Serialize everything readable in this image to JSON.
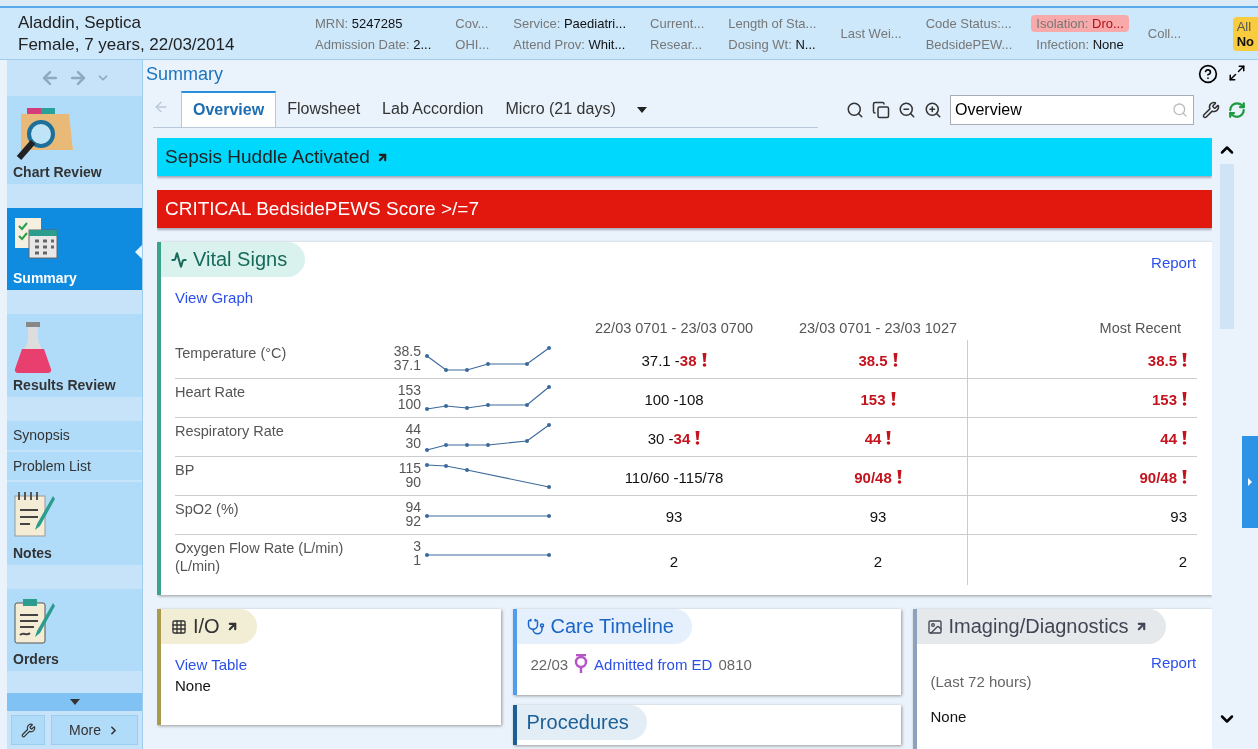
{
  "patient": {
    "name": "Aladdin, Septica",
    "details": "Female, 7 years, 22/03/2014"
  },
  "header_columns": [
    {
      "fields": [
        {
          "label": "MRN:",
          "value": "5247285",
          "highlight": false
        },
        {
          "label": "Admission Date:",
          "value": "2...",
          "highlight": false
        }
      ]
    },
    {
      "fields": [
        {
          "label": "Cov...",
          "highlight": false
        },
        {
          "label": "OHI...",
          "highlight": false
        }
      ]
    },
    {
      "fields": [
        {
          "label": "Service:",
          "value": "Paediatri...",
          "highlight": false
        },
        {
          "label": "Attend Prov:",
          "value": "Whit...",
          "highlight": false
        }
      ]
    },
    {
      "fields": [
        {
          "label": "Current...",
          "highlight": false
        },
        {
          "label": "Resear...",
          "highlight": false
        }
      ]
    },
    {
      "fields": [
        {
          "label": "Length of Sta...",
          "highlight": false
        },
        {
          "label": "Dosing Wt:",
          "value": "N...",
          "highlight": false
        }
      ]
    },
    {
      "fields": [
        {
          "label": "Last Wei...",
          "highlight": false
        }
      ]
    },
    {
      "fields": [
        {
          "label": "Code Status:...",
          "highlight": false
        },
        {
          "label": "BedsidePEW...",
          "highlight": false
        }
      ]
    },
    {
      "fields": [
        {
          "label": "Isolation:",
          "value": "Dro...",
          "highlight": true
        },
        {
          "label": "Infection:",
          "value": "None",
          "highlight": false
        }
      ]
    },
    {
      "fields": [
        {
          "label": "Coll...",
          "highlight": false
        }
      ]
    }
  ],
  "allergy_badge": {
    "label": "All",
    "value": "No"
  },
  "sidebar": {
    "items": [
      {
        "label": "Chart Review",
        "kind": "large",
        "selected": false
      },
      {
        "label": "Summary",
        "kind": "large",
        "selected": true
      },
      {
        "label": "Results Review",
        "kind": "large",
        "selected": false
      },
      {
        "label": "Synopsis",
        "kind": "small",
        "selected": false
      },
      {
        "label": "Problem List",
        "kind": "small",
        "selected": false
      },
      {
        "label": "Notes",
        "kind": "large",
        "selected": false
      },
      {
        "label": "Orders",
        "kind": "large",
        "selected": false
      }
    ],
    "more_button": "More"
  },
  "activity": {
    "title": "Summary",
    "tabs": [
      {
        "label": "Overview",
        "selected": true
      },
      {
        "label": "Flowsheet",
        "selected": false
      },
      {
        "label": "Lab Accordion",
        "selected": false
      },
      {
        "label": "Micro (21 days)",
        "selected": false
      }
    ],
    "search": {
      "value": "Overview"
    }
  },
  "banners": [
    {
      "text": "Sepsis Huddle Activated",
      "color": "#00d8fe",
      "linked": true
    },
    {
      "text": "CRITICAL BedsidePEWS Score >/=7",
      "color": "#e2180f",
      "linked": false
    }
  ],
  "vitals": {
    "title": "Vital Signs",
    "report_link": "Report",
    "graph_link": "View Graph",
    "columns": [
      "22/03 0701 - 23/03 0700",
      "23/03 0701 - 23/03 1027",
      "Most Recent"
    ],
    "rows": [
      {
        "name": "Temperature (°C)",
        "high": "38.5",
        "low": "37.1",
        "cells": [
          {
            "parts": [
              {
                "text": "37.1 -",
                "abnormal": false
              },
              {
                "text": "38",
                "abnormal": true
              }
            ],
            "flag": true
          },
          {
            "parts": [
              {
                "text": "38.5",
                "abnormal": true
              }
            ],
            "flag": true
          },
          {
            "parts": [
              {
                "text": "38.5",
                "abnormal": true
              }
            ],
            "flag": true
          }
        ]
      },
      {
        "name": "Heart Rate",
        "high": "153",
        "low": "100",
        "cells": [
          {
            "parts": [
              {
                "text": "100 -108",
                "abnormal": false
              }
            ],
            "flag": false
          },
          {
            "parts": [
              {
                "text": "153",
                "abnormal": true
              }
            ],
            "flag": true
          },
          {
            "parts": [
              {
                "text": "153",
                "abnormal": true
              }
            ],
            "flag": true
          }
        ]
      },
      {
        "name": "Respiratory Rate",
        "high": "44",
        "low": "30",
        "cells": [
          {
            "parts": [
              {
                "text": "30 -",
                "abnormal": false
              },
              {
                "text": "34",
                "abnormal": true
              }
            ],
            "flag": true
          },
          {
            "parts": [
              {
                "text": "44",
                "abnormal": true
              }
            ],
            "flag": true
          },
          {
            "parts": [
              {
                "text": "44",
                "abnormal": true
              }
            ],
            "flag": true
          }
        ]
      },
      {
        "name": "BP",
        "high": "115",
        "low": "90",
        "cells": [
          {
            "parts": [
              {
                "text": "110/60 -115/78",
                "abnormal": false
              }
            ],
            "flag": false
          },
          {
            "parts": [
              {
                "text": "90/48",
                "abnormal": true
              }
            ],
            "flag": true
          },
          {
            "parts": [
              {
                "text": "90/48",
                "abnormal": true
              }
            ],
            "flag": true
          }
        ]
      },
      {
        "name": "SpO2 (%)",
        "high": "94",
        "low": "92",
        "cells": [
          {
            "parts": [
              {
                "text": "93",
                "abnormal": false
              }
            ],
            "flag": false
          },
          {
            "parts": [
              {
                "text": "93",
                "abnormal": false
              }
            ],
            "flag": false
          },
          {
            "parts": [
              {
                "text": "93",
                "abnormal": false
              }
            ],
            "flag": false
          }
        ]
      },
      {
        "name": "Oxygen Flow Rate (L/min) (L/min)",
        "high": "3",
        "low": "1",
        "cells": [
          {
            "parts": [
              {
                "text": "2",
                "abnormal": false
              }
            ],
            "flag": false
          },
          {
            "parts": [
              {
                "text": "2",
                "abnormal": false
              }
            ],
            "flag": false
          },
          {
            "parts": [
              {
                "text": "2",
                "abnormal": false
              }
            ],
            "flag": false
          }
        ]
      }
    ]
  },
  "io": {
    "title": "I/O",
    "link": "View Table",
    "value": "None",
    "color": "#a99a4e"
  },
  "care_timeline": {
    "title": "Care Timeline",
    "date": "22/03",
    "event": "Admitted from ED",
    "time": "0810",
    "color": "#4f9cf0"
  },
  "procedures": {
    "title": "Procedures",
    "color": "#1b5f96"
  },
  "imaging": {
    "title": "Imaging/Diagnostics",
    "report_link": "Report",
    "note": "(Last 72 hours)",
    "value": "None",
    "color": "#8ea3bb"
  }
}
